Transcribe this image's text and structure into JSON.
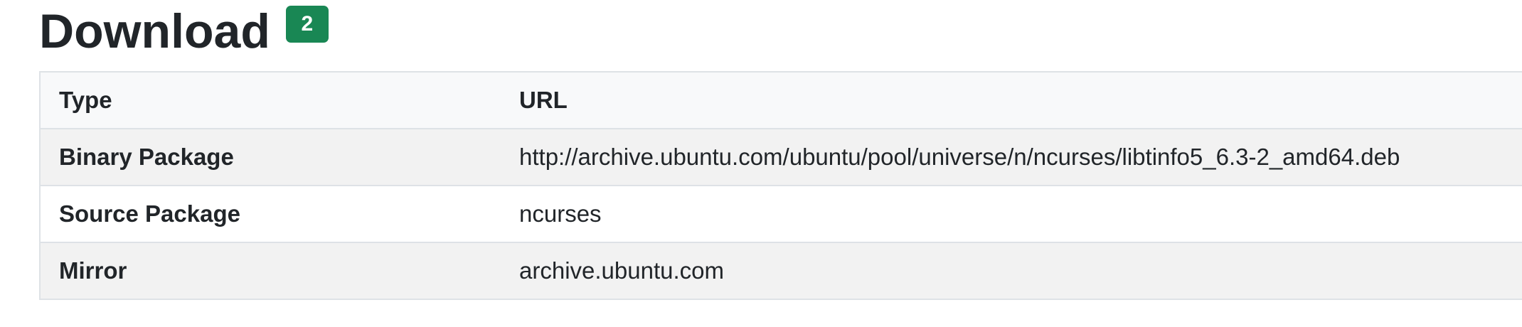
{
  "section": {
    "title": "Download",
    "badge_count": "2",
    "badge_color": "#198754"
  },
  "table": {
    "headers": {
      "type": "Type",
      "url": "URL"
    },
    "rows": [
      {
        "label": "Binary Package",
        "value": "http://archive.ubuntu.com/ubuntu/pool/universe/n/ncurses/libtinfo5_6.3-2_amd64.deb"
      },
      {
        "label": "Source Package",
        "value": "ncurses"
      },
      {
        "label": "Mirror",
        "value": "archive.ubuntu.com"
      }
    ]
  }
}
